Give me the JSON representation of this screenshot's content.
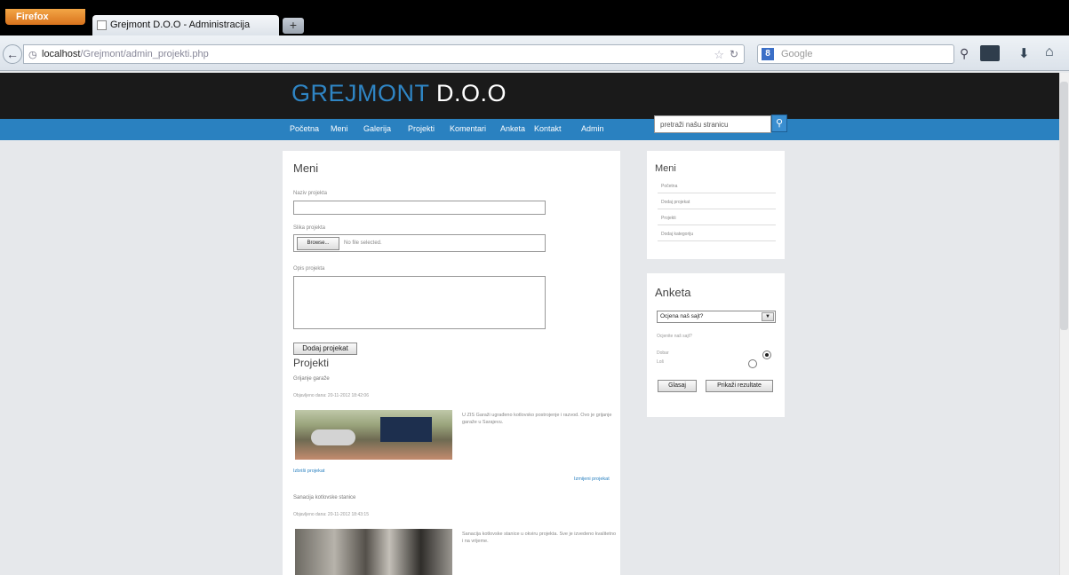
{
  "browser": {
    "app_button": "Firefox",
    "tab_title": "Grejmont D.O.O - Administracija",
    "new_tab": "+",
    "url_host": "localhost",
    "url_path": "/Grejmont/admin_projekti.php",
    "search_placeholder": "Google",
    "search_engine_letter": "8"
  },
  "site": {
    "logo_primary": "GREJMONT",
    "logo_secondary": "D.O.O",
    "nav": [
      "Početna",
      "Meni",
      "Galerija",
      "Projekti",
      "Komentari",
      "Anketa",
      "Kontakt",
      "Admin"
    ],
    "search_placeholder": "pretraži našu stranicu"
  },
  "form": {
    "heading": "Meni",
    "name_label": "Naziv projekta",
    "image_label": "Slika projekta",
    "browse_label": "Browse...",
    "file_status": "No file selected.",
    "desc_label": "Opis projekta",
    "submit_label": "Dodaj projekat"
  },
  "projects": {
    "heading": "Projekti",
    "items": [
      {
        "title": "Grijanje garaže",
        "date": "Objavljeno dana: 20-11-2012 18:42:06",
        "text": "U ZIS Garaži ugrađeno kotlovsko postrojenje i razvod. Ovo je grijanje garaže u Sarajevu.",
        "delete_label": "Izbriši projekat",
        "edit_label": "Izmijeni projekat"
      },
      {
        "title": "Sanacija kotlovske stanice",
        "date": "Objavljeno dana: 20-11-2012 18:43:15",
        "text": "Sanacija kotlovske stanice u okviru projekta. Sve je izvedeno kvalitetno i na vrijeme."
      }
    ]
  },
  "sidebar": {
    "menu_title": "Meni",
    "menu_items": [
      "Početna",
      "Dodaj projekat",
      "Projekti",
      "Dodaj kategoriju"
    ],
    "poll_title": "Anketa",
    "poll_select": "Ocjena naš sajt?",
    "poll_question": "Ocjenite naš sajt?",
    "poll_options": [
      "Dobar",
      "Loš"
    ],
    "vote_label": "Glasaj",
    "results_label": "Prikaži rezultate"
  },
  "colors": {
    "accent": "#2a81c0",
    "header": "#1a1a1a",
    "background": "#e6e8eb"
  }
}
